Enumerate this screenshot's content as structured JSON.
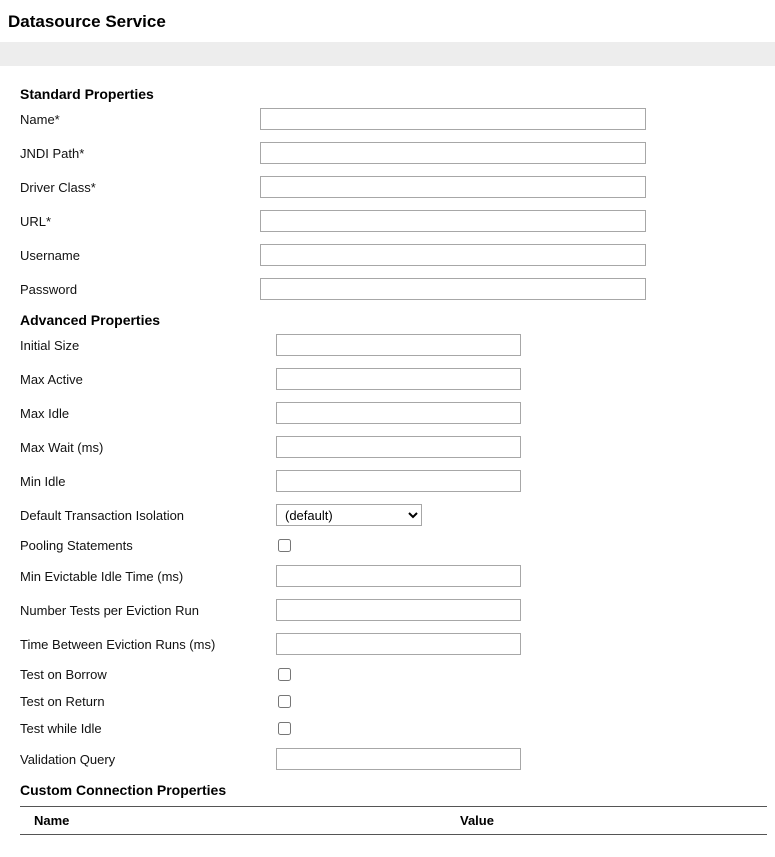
{
  "page": {
    "title": "Datasource Service"
  },
  "sections": {
    "standard": {
      "header": "Standard Properties",
      "fields": {
        "name": {
          "label": "Name*",
          "value": ""
        },
        "jndi_path": {
          "label": "JNDI Path*",
          "value": ""
        },
        "driver_class": {
          "label": "Driver Class*",
          "value": ""
        },
        "url": {
          "label": "URL*",
          "value": ""
        },
        "username": {
          "label": "Username",
          "value": ""
        },
        "password": {
          "label": "Password",
          "value": ""
        }
      }
    },
    "advanced": {
      "header": "Advanced Properties",
      "fields": {
        "initial_size": {
          "label": "Initial Size",
          "value": ""
        },
        "max_active": {
          "label": "Max Active",
          "value": ""
        },
        "max_idle": {
          "label": "Max Idle",
          "value": ""
        },
        "max_wait": {
          "label": "Max Wait (ms)",
          "value": ""
        },
        "min_idle": {
          "label": "Min Idle",
          "value": ""
        },
        "default_tx_isolation": {
          "label": "Default Transaction Isolation",
          "selected": "(default)",
          "options": [
            "(default)"
          ]
        },
        "pooling_statements": {
          "label": "Pooling Statements",
          "checked": false
        },
        "min_evictable_idle": {
          "label": "Min Evictable Idle Time (ms)",
          "value": ""
        },
        "num_tests_eviction": {
          "label": "Number Tests per Eviction Run",
          "value": ""
        },
        "time_between_eviction": {
          "label": "Time Between Eviction Runs (ms)",
          "value": ""
        },
        "test_on_borrow": {
          "label": "Test on Borrow",
          "checked": false
        },
        "test_on_return": {
          "label": "Test on Return",
          "checked": false
        },
        "test_while_idle": {
          "label": "Test while Idle",
          "checked": false
        },
        "validation_query": {
          "label": "Validation Query",
          "value": ""
        }
      }
    },
    "custom": {
      "header": "Custom Connection Properties",
      "columns": {
        "name": "Name",
        "value": "Value"
      },
      "rows": []
    }
  }
}
